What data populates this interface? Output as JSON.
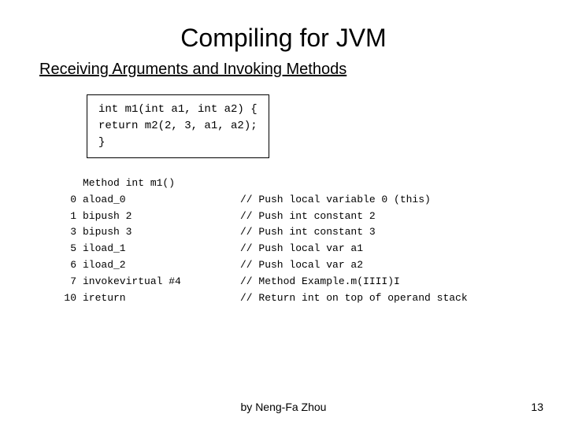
{
  "slide": {
    "title": "Compiling for JVM",
    "subtitle": "Receiving Arguments and Invoking Methods",
    "code_box": {
      "line1": "int  m1(int a1, int a2) {",
      "line2": "    return m2(2, 3, a1, a2);",
      "line3": "}"
    },
    "bytecode_header": "Method int m1()",
    "bytecode_rows": [
      {
        "num": "0",
        "instr": "aload_0",
        "comment": "// Push local variable 0 (this)"
      },
      {
        "num": "1",
        "instr": "bipush 2",
        "comment": "// Push int constant 2"
      },
      {
        "num": "3",
        "instr": "bipush 3",
        "comment": "// Push int constant 3"
      },
      {
        "num": "5",
        "instr": "iload_1",
        "comment": "// Push local var a1"
      },
      {
        "num": "6",
        "instr": "iload_2",
        "comment": "// Push local var a2"
      },
      {
        "num": "7",
        "instr": "invokevirtual #4",
        "comment": "// Method Example.m(IIII)I"
      },
      {
        "num": "10",
        "instr": "ireturn",
        "comment": "// Return int on top of operand stack"
      }
    ],
    "footer": "by Neng-Fa Zhou",
    "page_number": "13"
  }
}
